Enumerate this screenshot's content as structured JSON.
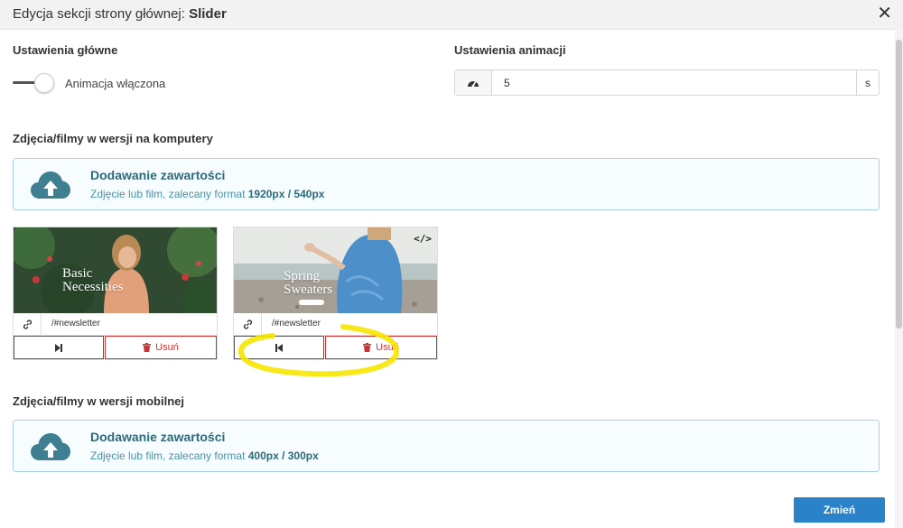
{
  "header": {
    "title_prefix": "Edycja sekcji strony głównej: ",
    "title_bold": "Slider",
    "close_icon": "close-icon"
  },
  "settings": {
    "main_label": "Ustawienia główne",
    "toggle_label": "Animacja włączona",
    "toggle_on": true,
    "anim_label": "Ustawienia animacji",
    "anim_value": "5",
    "anim_unit": "s",
    "anim_icon": "speedometer-icon"
  },
  "desktop": {
    "label": "Zdjęcia/filmy w wersji na komputery",
    "upload_title": "Dodawanie zawartości",
    "upload_sub": "Zdjęcie lub film, zalecany format ",
    "upload_format": "1920px / 540px",
    "items": [
      {
        "slide_text": "Basic\nNecessities",
        "link": "/#newsletter",
        "delete_label": "Usuń",
        "move_icon": "move-right-icon"
      },
      {
        "slide_text": "Spring\nSweaters",
        "link": "/#newsletter",
        "delete_label": "Usuń",
        "move_icon": "move-left-icon",
        "code_icon": "</>"
      }
    ]
  },
  "mobile": {
    "label": "Zdjęcia/filmy w wersji mobilnej",
    "upload_title": "Dodawanie zawartości",
    "upload_sub": "Zdjęcie lub film, zalecany format ",
    "upload_format": "400px / 300px"
  },
  "submit_label": "Zmień",
  "colors": {
    "accent": "#2a82c9",
    "upload_border": "#a9d3de",
    "danger": "#cc3333",
    "highlight": "#f5e600"
  }
}
